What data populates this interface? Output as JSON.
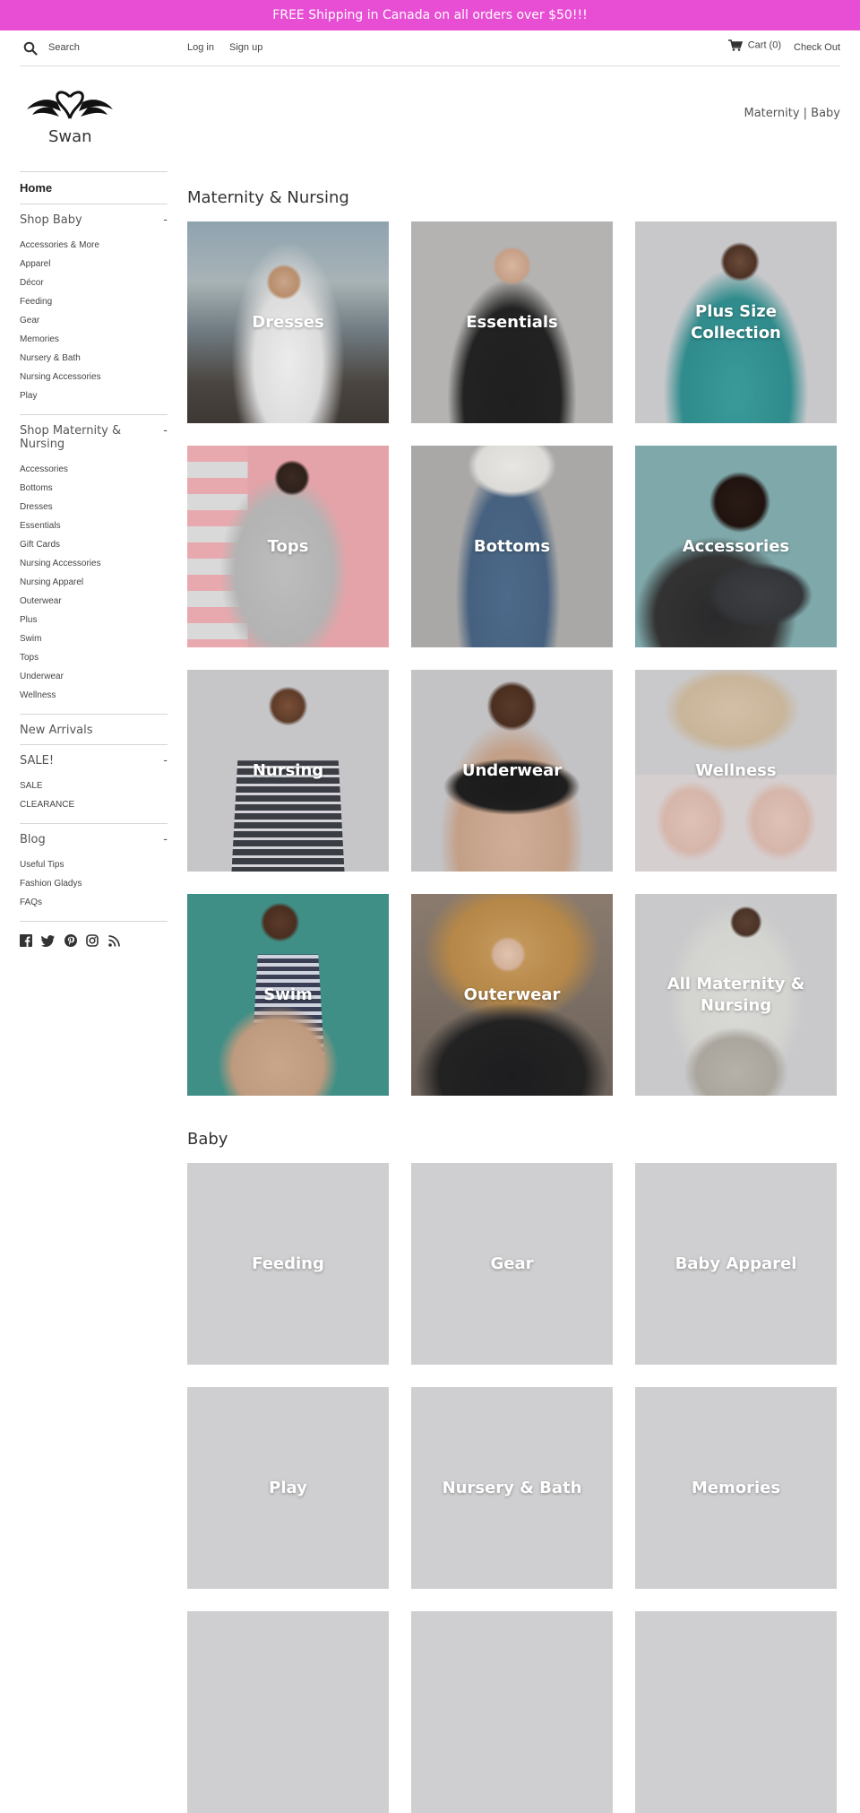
{
  "banner": {
    "text": "FREE Shipping in Canada on all orders over $50!!!",
    "color": "#e84ed4"
  },
  "topbar": {
    "search_placeholder": "Search",
    "login": "Log in",
    "signup": "Sign up",
    "cart": "Cart (0)",
    "checkout": "Check Out"
  },
  "brand": {
    "name": "Swan"
  },
  "header_nav": "Maternity | Baby",
  "sidebar": {
    "home": "Home",
    "sections": [
      {
        "title": "Shop Baby",
        "toggle": "-",
        "items": [
          "Accessories & More",
          "Apparel",
          "Décor",
          "Feeding",
          "Gear",
          "Memories",
          "Nursery & Bath",
          "Nursing Accessories",
          "Play"
        ]
      },
      {
        "title": "Shop Maternity & Nursing",
        "toggle": "-",
        "items": [
          "Accessories",
          "Bottoms",
          "Dresses",
          "Essentials",
          "Gift Cards",
          "Nursing Accessories",
          "Nursing Apparel",
          "Outerwear",
          "Plus",
          "Swim",
          "Tops",
          "Underwear",
          "Wellness"
        ]
      },
      {
        "title": "New Arrivals",
        "toggle": "",
        "items": []
      },
      {
        "title": "SALE!",
        "toggle": "-",
        "items": [
          "SALE",
          "CLEARANCE"
        ]
      },
      {
        "title": "Blog",
        "toggle": "-",
        "items": [
          "Useful Tips",
          "Fashion Gladys",
          "FAQs"
        ]
      }
    ],
    "social_icons": [
      "facebook-icon",
      "twitter-icon",
      "pinterest-icon",
      "instagram-icon",
      "rss-icon"
    ]
  },
  "maternity": {
    "title": "Maternity & Nursing",
    "tiles": [
      {
        "label": "Dresses"
      },
      {
        "label": "Essentials"
      },
      {
        "label": "Plus Size Collection"
      },
      {
        "label": "Tops"
      },
      {
        "label": "Bottoms"
      },
      {
        "label": "Accessories"
      },
      {
        "label": "Nursing"
      },
      {
        "label": "Underwear"
      },
      {
        "label": "Wellness"
      },
      {
        "label": "Swim"
      },
      {
        "label": "Outerwear"
      },
      {
        "label": "All Maternity & Nursing"
      }
    ]
  },
  "baby": {
    "title": "Baby",
    "tiles": [
      {
        "label": "Feeding"
      },
      {
        "label": "Gear"
      },
      {
        "label": "Baby Apparel"
      },
      {
        "label": "Play"
      },
      {
        "label": "Nursery & Bath"
      },
      {
        "label": "Memories"
      },
      {
        "label": ""
      },
      {
        "label": ""
      },
      {
        "label": ""
      }
    ]
  }
}
